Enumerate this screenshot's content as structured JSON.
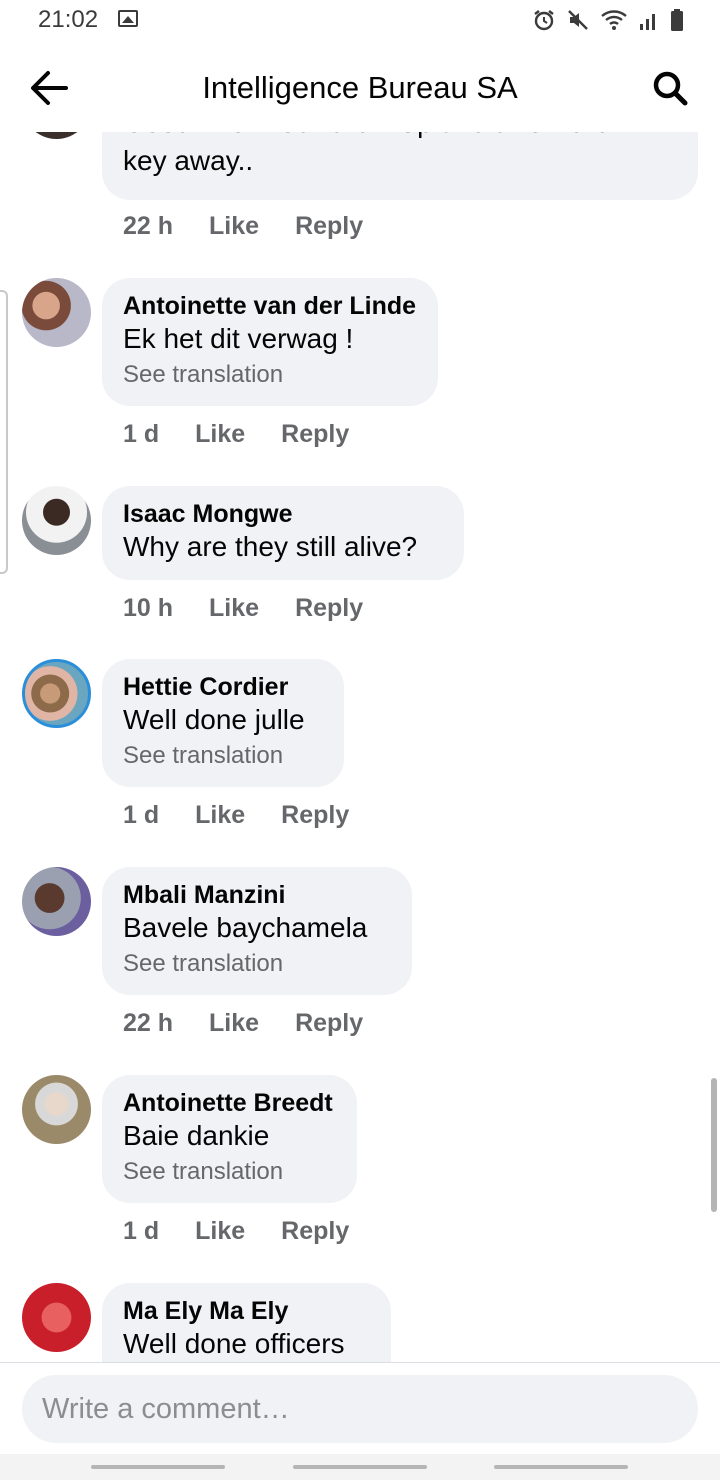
{
  "status_bar": {
    "time": "21:02"
  },
  "header": {
    "title": "Intelligence Bureau SA"
  },
  "comments": [
    {
      "text_line1": "Good ..now lock them up and throw the",
      "text_line2": "key away..",
      "time": "22 h",
      "like": "Like",
      "reply": "Reply"
    },
    {
      "author": "Antoinette van der Linde",
      "text": "Ek het dit verwag !",
      "translation": "See translation",
      "time": "1 d",
      "like": "Like",
      "reply": "Reply"
    },
    {
      "author": "Isaac Mongwe",
      "text": "Why are they still alive?",
      "time": "10 h",
      "like": "Like",
      "reply": "Reply"
    },
    {
      "author": "Hettie Cordier",
      "text": "Well done julle",
      "translation": "See translation",
      "time": "1 d",
      "like": "Like",
      "reply": "Reply"
    },
    {
      "author": "Mbali Manzini",
      "text": "Bavele baychamela",
      "translation": "See translation",
      "time": "22 h",
      "like": "Like",
      "reply": "Reply"
    },
    {
      "author": "Antoinette Breedt",
      "text": "Baie dankie",
      "translation": "See translation",
      "time": "1 d",
      "like": "Like",
      "reply": "Reply"
    },
    {
      "author": "Ma Ely Ma Ely",
      "text": "Well done officers"
    }
  ],
  "composer": {
    "placeholder": "Write a comment…"
  },
  "colors": {
    "bubble": "#f0f2f5",
    "muted": "#65676b",
    "text": "#050505"
  }
}
